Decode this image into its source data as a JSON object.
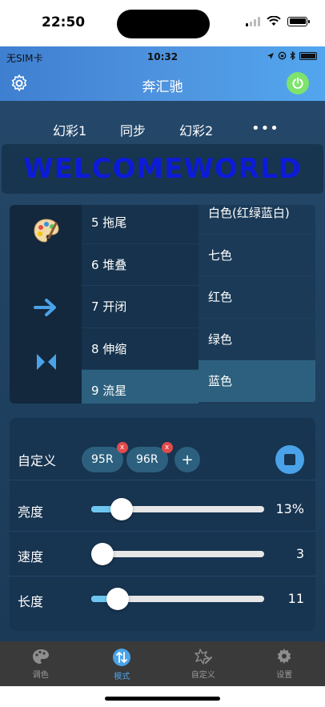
{
  "os_status": {
    "time": "22:50"
  },
  "inner_status": {
    "carrier": "无SIM卡",
    "time": "10:32"
  },
  "app": {
    "title": "奔汇驰",
    "accent": "#4aa3e8",
    "power_color": "#7de36c"
  },
  "tabs": [
    {
      "label": "幻彩1"
    },
    {
      "label": "同步"
    },
    {
      "label": "幻彩2"
    },
    {
      "label": "•••"
    }
  ],
  "banner": {
    "text": "WELCOMEWORLD",
    "color": "#0c1bd8"
  },
  "mode_icons": [
    "palette-icon",
    "arrow-right-icon",
    "converge-arrows-icon"
  ],
  "modes": [
    {
      "label": "5 拖尾",
      "selected": false
    },
    {
      "label": "6 堆叠",
      "selected": false
    },
    {
      "label": "7 开闭",
      "selected": false
    },
    {
      "label": "8 伸缩",
      "selected": false
    },
    {
      "label": "9 流星",
      "selected": true
    }
  ],
  "colors": [
    {
      "label": "白色(红绿蓝白)",
      "selected": false
    },
    {
      "label": "七色",
      "selected": false
    },
    {
      "label": "红色",
      "selected": false
    },
    {
      "label": "绿色",
      "selected": false
    },
    {
      "label": "蓝色",
      "selected": true
    }
  ],
  "custom": {
    "label": "自定义",
    "chips": [
      {
        "label": "95R",
        "remove": "x"
      },
      {
        "label": "96R",
        "remove": "x"
      }
    ],
    "add": "+"
  },
  "sliders": [
    {
      "label": "亮度",
      "value_text": "13%",
      "fraction": 0.13,
      "show_fill": true
    },
    {
      "label": "速度",
      "value_text": "3",
      "fraction": 0.0,
      "show_fill": false
    },
    {
      "label": "长度",
      "value_text": "11",
      "fraction": 0.1,
      "show_fill": true
    }
  ],
  "tabbar": [
    {
      "label": "调色",
      "icon": "palette-icon",
      "active": false
    },
    {
      "label": "模式",
      "icon": "mode-swap-icon",
      "active": true
    },
    {
      "label": "自定义",
      "icon": "edit-shape-icon",
      "active": false
    },
    {
      "label": "设置",
      "icon": "gear-icon",
      "active": false
    }
  ]
}
